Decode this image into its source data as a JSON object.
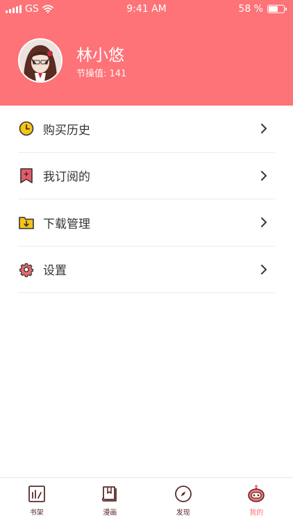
{
  "status_bar": {
    "carrier": "GS",
    "time": "9:41 AM",
    "battery_text": "58 %",
    "battery_level": 0.58
  },
  "profile": {
    "name": "林小悠",
    "points_label": "节操值: 141"
  },
  "menu": {
    "items": [
      {
        "label": "购买历史",
        "icon": "clock-icon"
      },
      {
        "label": "我订阅的",
        "icon": "bookmark-icon"
      },
      {
        "label": "下载管理",
        "icon": "download-folder-icon"
      },
      {
        "label": "设置",
        "icon": "gear-icon"
      }
    ]
  },
  "tabbar": {
    "tabs": [
      {
        "label": "书架",
        "icon": "bookshelf-icon",
        "active": false
      },
      {
        "label": "漫画",
        "icon": "book-icon",
        "active": false
      },
      {
        "label": "发现",
        "icon": "compass-icon",
        "active": false
      },
      {
        "label": "我的",
        "icon": "robot-icon",
        "active": true
      }
    ]
  },
  "colors": {
    "header": "#fd7378",
    "clock": "#f5c518",
    "folder": "#f5c518",
    "bookmark": "#e85a6a",
    "gear": "#f06a6f",
    "tab_inactive": "#5b2a2a",
    "tab_active": "#fd7378"
  }
}
